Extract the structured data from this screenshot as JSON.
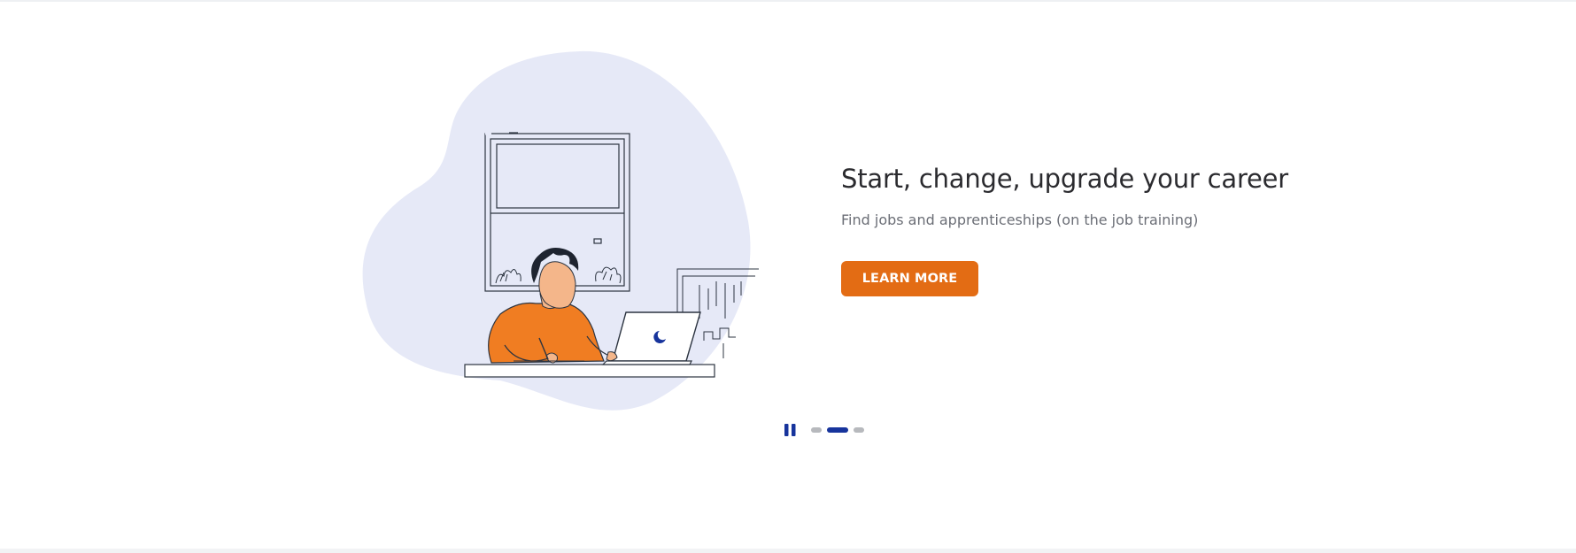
{
  "hero": {
    "title": "Start, change, upgrade your career",
    "subtitle": "Find jobs and apprenticeships (on the job training)",
    "cta_label": "LEARN MORE",
    "illustration": "person-working-at-laptop-illustration"
  },
  "carousel": {
    "pause_icon": "pause-icon",
    "slide_count": 3,
    "active_slide": 2
  },
  "colors": {
    "accent": "#e36c14",
    "brand": "#17349c",
    "blob": "#e6e9f7",
    "title_text": "#2b2b2f",
    "subtitle_text": "#6b6e76",
    "inactive_dot": "#b7b9bd"
  }
}
